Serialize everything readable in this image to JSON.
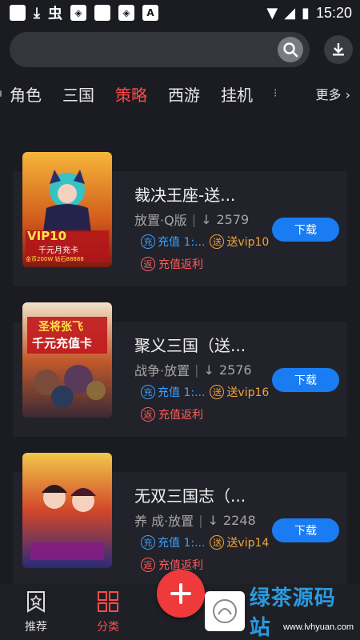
{
  "status_bar": {
    "time": "15:20"
  },
  "search": {
    "placeholder": ""
  },
  "categories": {
    "tabs": [
      "角色",
      "三国",
      "策略",
      "西游",
      "挂机"
    ],
    "active_index": 2,
    "more_label": "更多"
  },
  "games": [
    {
      "title": "裁决王座-送...",
      "genre": "放置·Q版",
      "downloads": "2579",
      "tag1": "充值 1:...",
      "tag2": "送vip10",
      "rebate": "充值返利",
      "button": "下载",
      "cover_text_1": "VIP10",
      "cover_text_2": "千元月充卡",
      "cover_text_3": "金币200W 钻石88888"
    },
    {
      "title": "聚义三国（送...",
      "genre": "战争·放置",
      "downloads": "2576",
      "tag1": "充值 1:...",
      "tag2": "送vip16",
      "rebate": "充值返利",
      "button": "下载",
      "cover_text_1": "圣将张飞",
      "cover_text_2": "千元充值卡"
    },
    {
      "title": "无双三国志（...",
      "genre": "养 成·放置",
      "downloads": "2248",
      "tag1": "充值 1:...",
      "tag2": "送vip14",
      "rebate": "充值返利",
      "button": "下载"
    }
  ],
  "bottom_nav": {
    "recommend": "推荐",
    "category": "分类"
  },
  "watermark": {
    "text": "绿茶源码站",
    "url": "www.lvhyuan.com"
  },
  "colors": {
    "accent": "#ff4a4a",
    "download_blue": "#1a7cf2",
    "vip_orange": "#f2a33a"
  }
}
